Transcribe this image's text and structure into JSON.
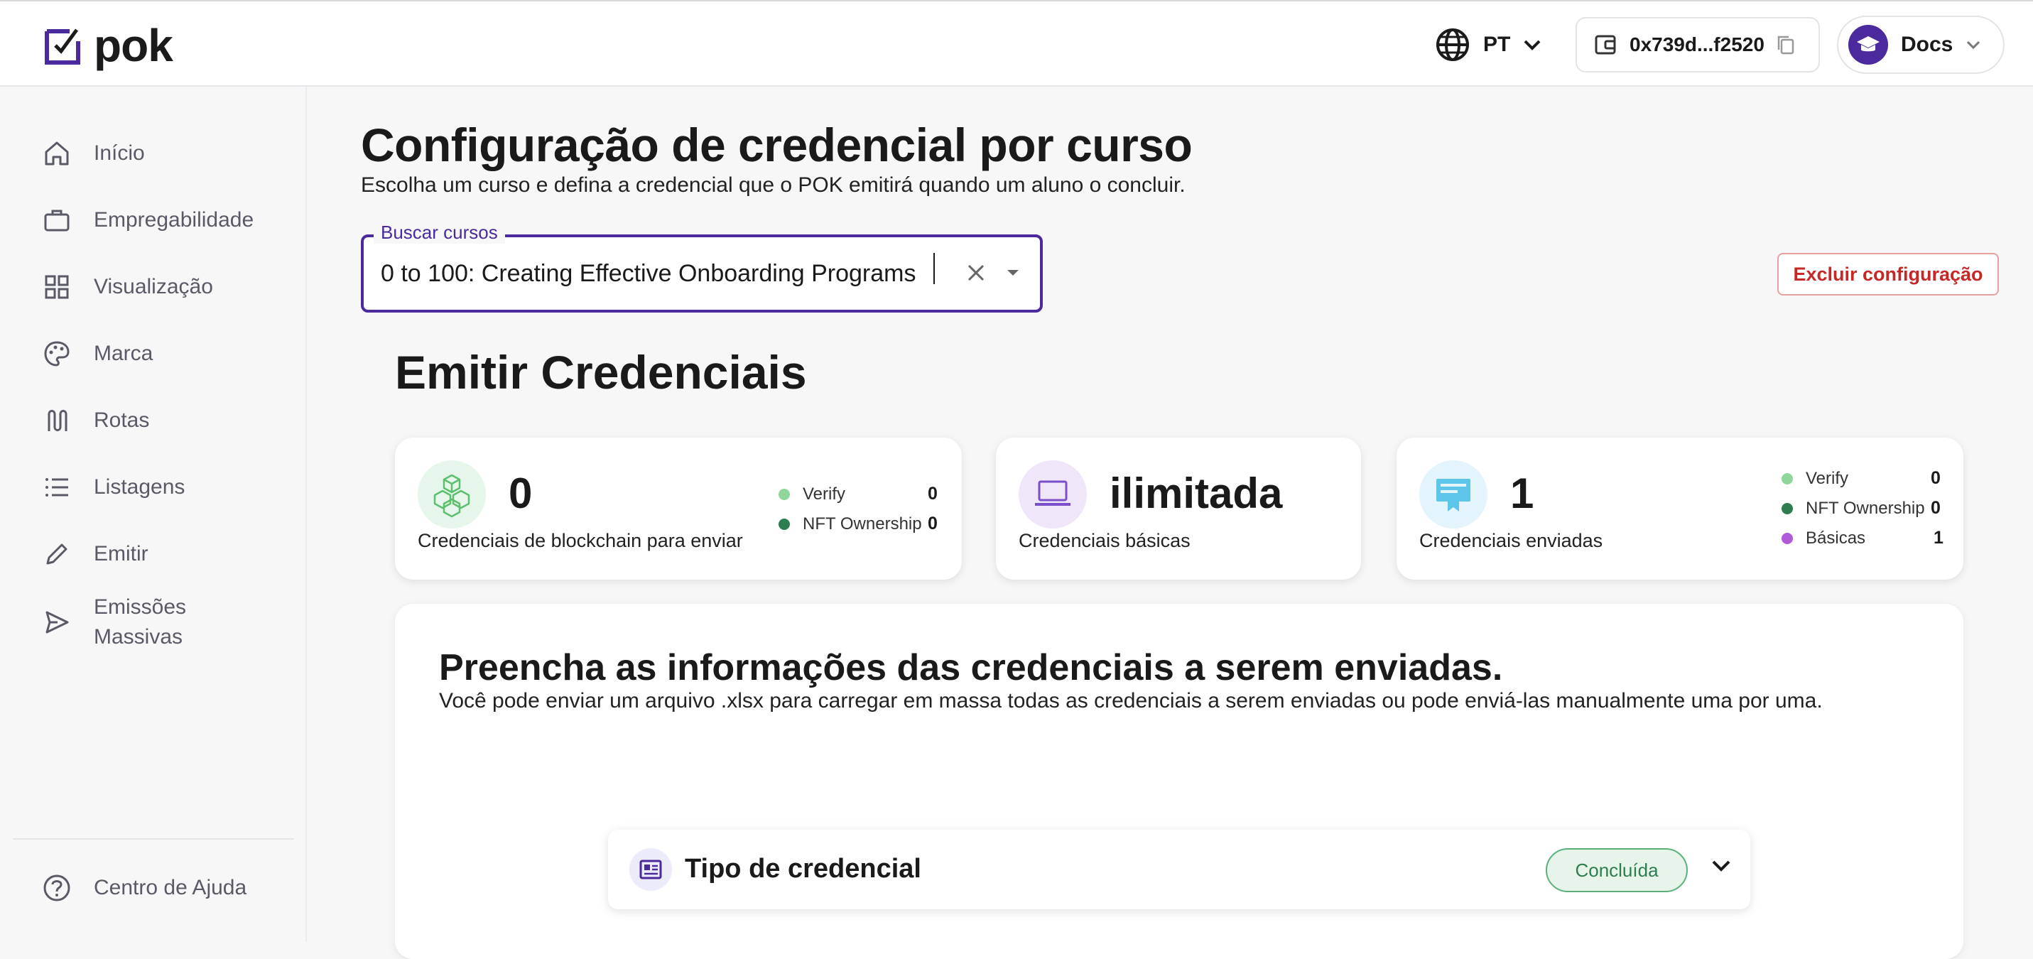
{
  "header": {
    "logo_text": "pok",
    "language": "PT",
    "wallet_address": "0x739d...f2520",
    "profile_name": "Docs"
  },
  "sidebar": {
    "items": [
      {
        "label": "Início",
        "icon": "home-icon"
      },
      {
        "label": "Empregabilidade",
        "icon": "briefcase-icon"
      },
      {
        "label": "Visualização",
        "icon": "grid-icon"
      },
      {
        "label": "Marca",
        "icon": "palette-icon"
      },
      {
        "label": "Rotas",
        "icon": "route-icon"
      },
      {
        "label": "Listagens",
        "icon": "list-icon"
      },
      {
        "label": "Emitir",
        "icon": "pencil-icon"
      },
      {
        "label": "Emissões Massivas",
        "icon": "send-icon"
      }
    ],
    "help_label": "Centro de Ajuda"
  },
  "page": {
    "title": "Configuração de credencial por curso",
    "subtitle": "Escolha um curso e defina a credencial que o POK emitirá quando um aluno o concluir."
  },
  "search": {
    "label": "Buscar cursos",
    "value": "0 to 100: Creating Effective Onboarding Programs"
  },
  "delete_button": "Excluir configuração",
  "issue": {
    "title": "Emitir Credenciais",
    "cards": {
      "blockchain": {
        "value": "0",
        "label": "Credenciais de blockchain para enviar",
        "legend": [
          {
            "name": "Verify",
            "value": "0",
            "color": "#8fd69a"
          },
          {
            "name": "NFT Ownership",
            "value": "0",
            "color": "#2e7d4f"
          }
        ]
      },
      "basic": {
        "value": "ilimitada",
        "label": "Credenciais básicas"
      },
      "sent": {
        "value": "1",
        "label": "Credenciais enviadas",
        "legend": [
          {
            "name": "Verify",
            "value": "0",
            "color": "#8fd69a"
          },
          {
            "name": "NFT Ownership",
            "value": "0",
            "color": "#2e7d4f"
          },
          {
            "name": "Básicas",
            "value": "1",
            "color": "#b15ad8"
          }
        ]
      }
    }
  },
  "form": {
    "title": "Preencha as informações das credenciais a serem enviadas.",
    "description": "Você pode enviar um arquivo .xlsx para carregar em massa todas as credenciais a serem enviadas ou pode enviá-las manualmente uma por uma.",
    "accordion": {
      "title": "Tipo de credencial",
      "status": "Concluída"
    }
  },
  "colors": {
    "brand": "#4b2a9e",
    "danger": "#c62828",
    "success": "#2e7d4f"
  }
}
